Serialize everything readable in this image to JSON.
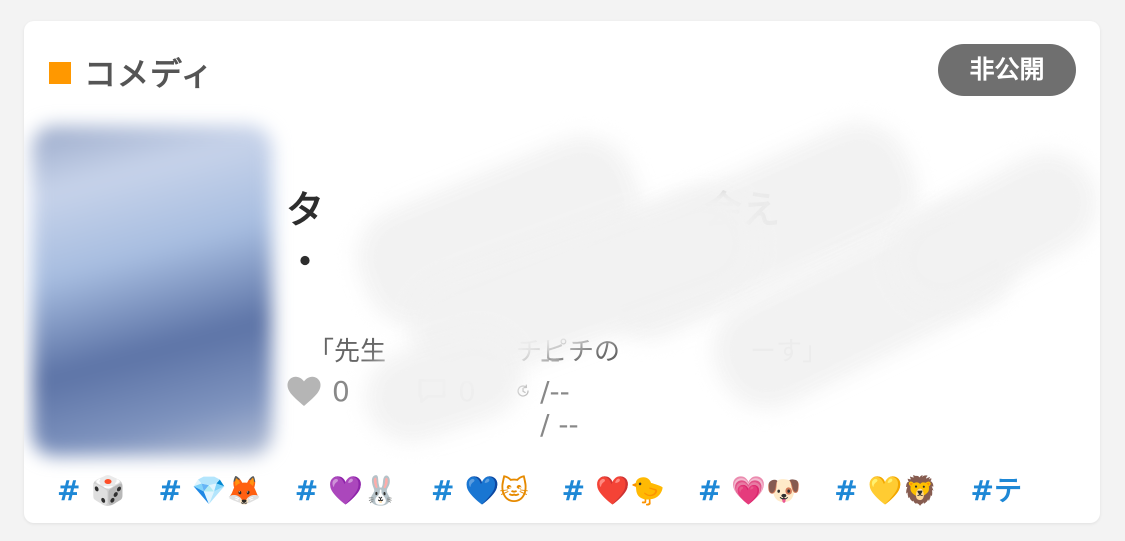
{
  "category": {
    "label": "コメディ",
    "color": "#ff9800"
  },
  "visibility_badge": "非公開",
  "work": {
    "title_line1": "タ　　　　　　　　　　会え",
    "title_line2": "・",
    "description": "「先生　　　　　チピチの　　　　　ーす」",
    "likes": "0",
    "comments": "0",
    "updated": "-- /-- / --"
  },
  "tags": [
    {
      "hash": "#",
      "emoji": "🎲"
    },
    {
      "hash": "#",
      "emoji": "💎🦊"
    },
    {
      "hash": "#",
      "emoji": "💜🐰"
    },
    {
      "hash": "#",
      "emoji": "💙🐱"
    },
    {
      "hash": "#",
      "emoji": "❤️🐤"
    },
    {
      "hash": "#",
      "emoji": "💗🐶"
    },
    {
      "hash": "#",
      "emoji": "💛🦁"
    },
    {
      "hash": "#テ",
      "emoji": ""
    }
  ]
}
